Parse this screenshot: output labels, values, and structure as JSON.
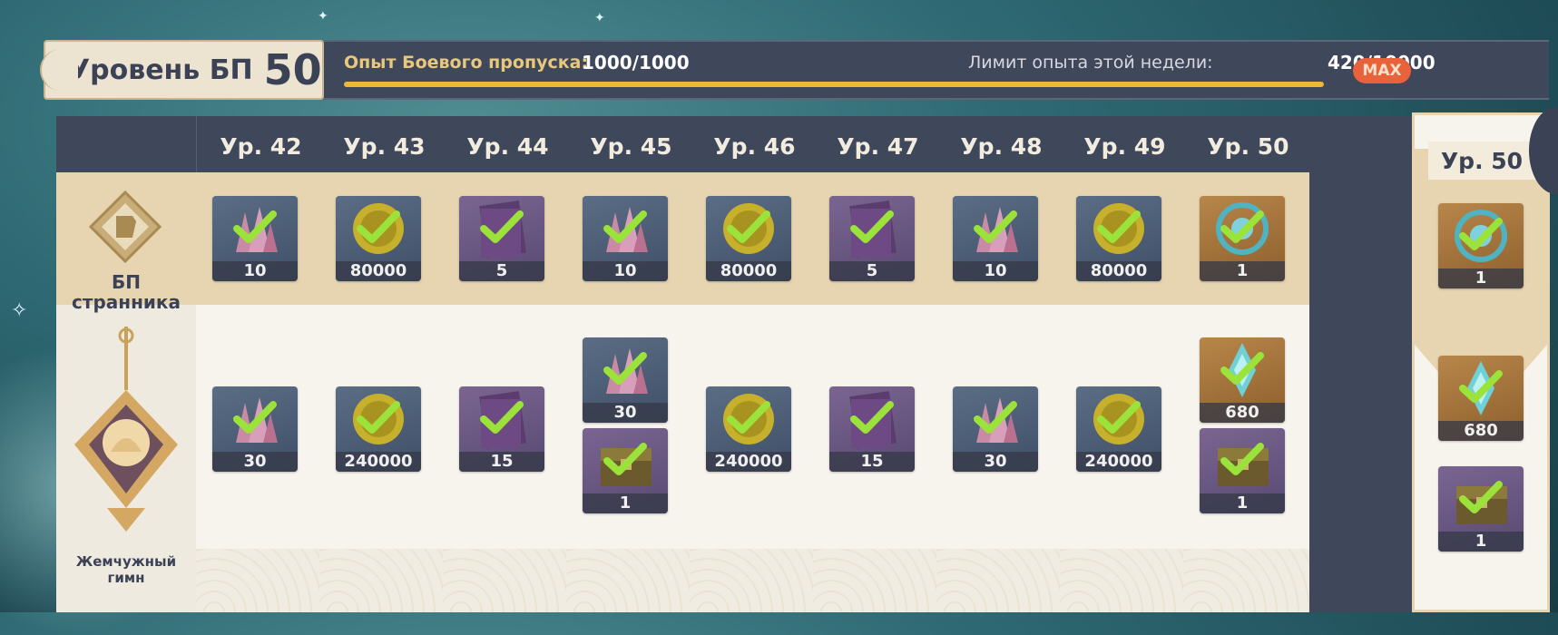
{
  "header": {
    "level_label": "Уровень БП",
    "level_value": "50",
    "exp_label": "Опыт Боевого пропуска:",
    "exp_value": "1000/1000",
    "weekly_label": "Лимит опыта этой недели:",
    "weekly_value": "420/10000",
    "max_label": "MAX",
    "exp_progress_fraction": 1.0
  },
  "side": {
    "free_track_label": "БП странника",
    "paid_track_name": "Жемчужный гимн"
  },
  "columns": [
    {
      "level": "Ур. 42",
      "free": [
        {
          "type": "crystal",
          "count": "10"
        }
      ],
      "paid": [
        {
          "type": "crystal",
          "count": "30"
        }
      ]
    },
    {
      "level": "Ур. 43",
      "free": [
        {
          "type": "mora",
          "count": "80000"
        }
      ],
      "paid": [
        {
          "type": "mora",
          "count": "240000"
        }
      ]
    },
    {
      "level": "Ур. 44",
      "free": [
        {
          "type": "book",
          "count": "5"
        }
      ],
      "paid": [
        {
          "type": "book",
          "count": "15"
        }
      ]
    },
    {
      "level": "Ур. 45",
      "free": [
        {
          "type": "crystal",
          "count": "10"
        }
      ],
      "paid": [
        {
          "type": "crystal",
          "count": "30"
        },
        {
          "type": "chest",
          "count": "1"
        }
      ]
    },
    {
      "level": "Ур. 46",
      "free": [
        {
          "type": "mora",
          "count": "80000"
        }
      ],
      "paid": [
        {
          "type": "mora",
          "count": "240000"
        }
      ]
    },
    {
      "level": "Ур. 47",
      "free": [
        {
          "type": "book",
          "count": "5"
        }
      ],
      "paid": [
        {
          "type": "book",
          "count": "15"
        }
      ]
    },
    {
      "level": "Ур. 48",
      "free": [
        {
          "type": "crystal",
          "count": "10"
        }
      ],
      "paid": [
        {
          "type": "crystal",
          "count": "30"
        }
      ]
    },
    {
      "level": "Ур. 49",
      "free": [
        {
          "type": "mora",
          "count": "80000"
        }
      ],
      "paid": [
        {
          "type": "mora",
          "count": "240000"
        }
      ]
    },
    {
      "level": "Ур. 50",
      "free": [
        {
          "type": "fate",
          "count": "1"
        }
      ],
      "paid": [
        {
          "type": "primogem",
          "count": "680"
        },
        {
          "type": "chest",
          "count": "1"
        }
      ]
    }
  ],
  "featured": {
    "level": "Ур. 50",
    "free": [
      {
        "type": "fate",
        "count": "1"
      }
    ],
    "paid": [
      {
        "type": "primogem",
        "count": "680"
      },
      {
        "type": "chest",
        "count": "1"
      }
    ]
  },
  "colors": {
    "panel_dark": "#3f475b",
    "free_row": "#e6d5b0",
    "card_bg": "#f7f4ed",
    "progress": "#f2b637",
    "check": "#9be23a",
    "max_pill": "#e8623b"
  }
}
